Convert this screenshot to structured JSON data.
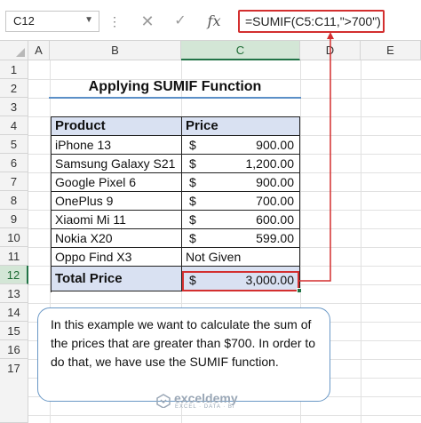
{
  "formula_bar": {
    "name_box": "C12",
    "formula": "=SUMIF(C5:C11,\">700\")",
    "fx_label": "fx"
  },
  "columns": [
    "A",
    "B",
    "C",
    "D",
    "E"
  ],
  "rows": [
    "1",
    "2",
    "3",
    "4",
    "5",
    "6",
    "7",
    "8",
    "9",
    "10",
    "11",
    "12",
    "13",
    "14",
    "15",
    "16",
    "17"
  ],
  "title": "Applying SUMIF Function",
  "table": {
    "headers": [
      "Product",
      "Price"
    ],
    "rows": [
      {
        "product": "iPhone 13",
        "currency": "$",
        "price": "900.00"
      },
      {
        "product": "Samsung Galaxy S21",
        "currency": "$",
        "price": "1,200.00"
      },
      {
        "product": "Google Pixel 6",
        "currency": "$",
        "price": "900.00"
      },
      {
        "product": "OnePlus 9",
        "currency": "$",
        "price": "700.00"
      },
      {
        "product": "Xiaomi Mi 11",
        "currency": "$",
        "price": "600.00"
      },
      {
        "product": "Nokia X20",
        "currency": "$",
        "price": "599.00"
      },
      {
        "product": "Oppo Find X3",
        "currency": "",
        "price": "Not Given"
      }
    ],
    "total": {
      "label": "Total Price",
      "currency": "$",
      "value": "3,000.00"
    }
  },
  "note": "In this example we want to calculate the sum of the prices that are greater than $700. In order to do that, we have use the SUMIF function.",
  "watermark": {
    "brand": "exceldemy",
    "tagline": "EXCEL · DATA · BI"
  },
  "colors": {
    "accent_red": "#d32f2f",
    "header_fill": "#d9e1f2",
    "excel_green": "#217346"
  }
}
